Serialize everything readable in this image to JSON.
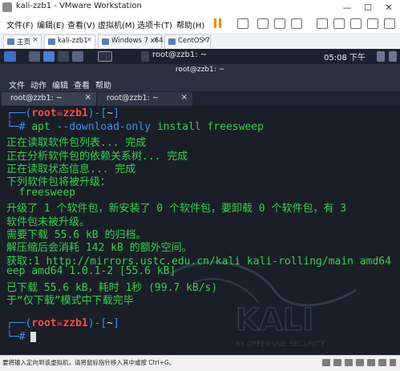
{
  "vmware": {
    "title": "kali-zzb1 - VMware Workstation",
    "window_controls": [
      "—",
      "☐",
      "✕"
    ],
    "menu": [
      "文件(F)",
      "编辑(E)",
      "查看(V)",
      "虚拟机(M)",
      "选项卡(T)",
      "帮助(H)"
    ],
    "tabs": [
      {
        "label": "主页",
        "active": false
      },
      {
        "label": "kali-zzb1",
        "active": true
      },
      {
        "label": "Windows 7 x64",
        "active": false
      },
      {
        "label": "CentOS 7",
        "active": false
      }
    ],
    "status_text": "要将输入定向到该虚拟机，请将鼠标指针移入其中或按 Ctrl+G。"
  },
  "kali_panel": {
    "terminal_label": "root@zzb1: ~",
    "clock": "05:08 下午"
  },
  "terminal": {
    "title": "root@zzb1: ~",
    "menu": [
      "文件",
      "动作",
      "编辑",
      "查看",
      "帮助"
    ],
    "tabs": [
      {
        "label": "root@zzb1: ~",
        "active": true
      },
      {
        "label": "root@zzb1: ~",
        "active": false
      }
    ],
    "prompt": {
      "user": "root",
      "host": "zzb1",
      "path": "~",
      "symbol": "#"
    },
    "command": {
      "name": "apt",
      "option": "--download-only",
      "args": "install freesweep"
    },
    "output": [
      "正在读取软件包列表... 完成",
      "正在分析软件包的依赖关系树... 完成",
      "正在读取状态信息... 完成",
      "下列软件包将被升级：",
      "  freesweep",
      "升级了 1 个软件包，新安装了 0 个软件包，要卸载 0 个软件包，有 3",
      "软件包未被升级。",
      "需要下载 55.6 kB 的归档。",
      "解压缩后会消耗 142 kB 的额外空间。",
      "获取:1 http://mirrors.ustc.edu.cn/kali kali-rolling/main amd64",
      "eep amd64 1.0.1-2 [55.6 kB]",
      "已下载 55.6 kB，耗时 1秒 (99.7 kB/s)",
      "于“仅下载”模式中下载完毕"
    ],
    "watermark": {
      "brand": "KALI",
      "tagline": "BY OFFENSIVE SECURITY"
    }
  },
  "colors": {
    "terminal_bg": "#1a1e27",
    "text_green": "#33d14f",
    "prompt_blue": "#3f8ff0",
    "prompt_red": "#ff4b4b"
  }
}
